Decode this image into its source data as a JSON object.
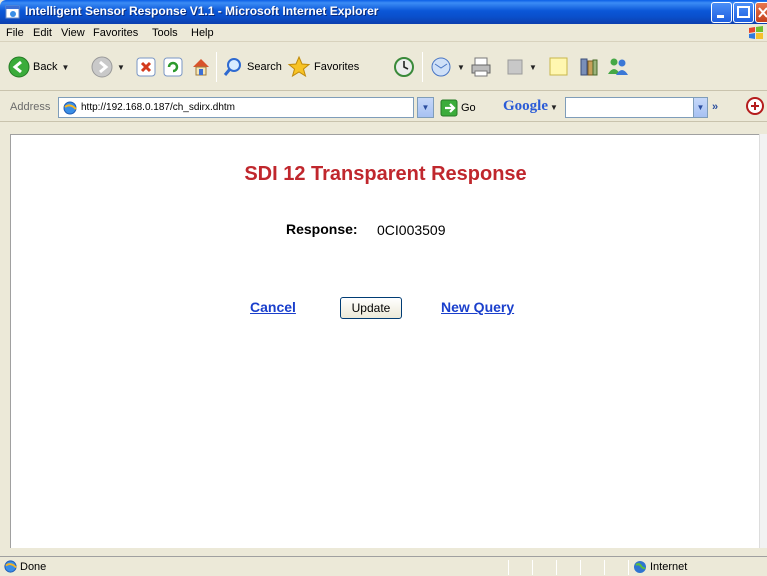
{
  "window": {
    "title": "Intelligent Sensor Response V1.1 - Microsoft Internet Explorer"
  },
  "menu": [
    "File",
    "Edit",
    "View",
    "Favorites",
    "Tools",
    "Help"
  ],
  "toolbar": {
    "back_label": "Back",
    "search_label": "Search",
    "favorites_label": "Favorites"
  },
  "address": {
    "label": "Address",
    "url": "http://192.168.0.187/ch_sdirx.dhtm",
    "go_label": "Go",
    "google_label": "Google",
    "google_value": ""
  },
  "page": {
    "heading": "SDI 12 Transparent Response",
    "response_label": "Response:",
    "response_value": "0CI003509",
    "cancel_label": "Cancel",
    "update_label": "Update",
    "new_query_label": "New Query"
  },
  "status": {
    "text": "Done",
    "zone": "Internet"
  },
  "colors": {
    "heading": "#C0272D",
    "link": "#1A3FCC",
    "titlebar": "#0A4FCB"
  }
}
